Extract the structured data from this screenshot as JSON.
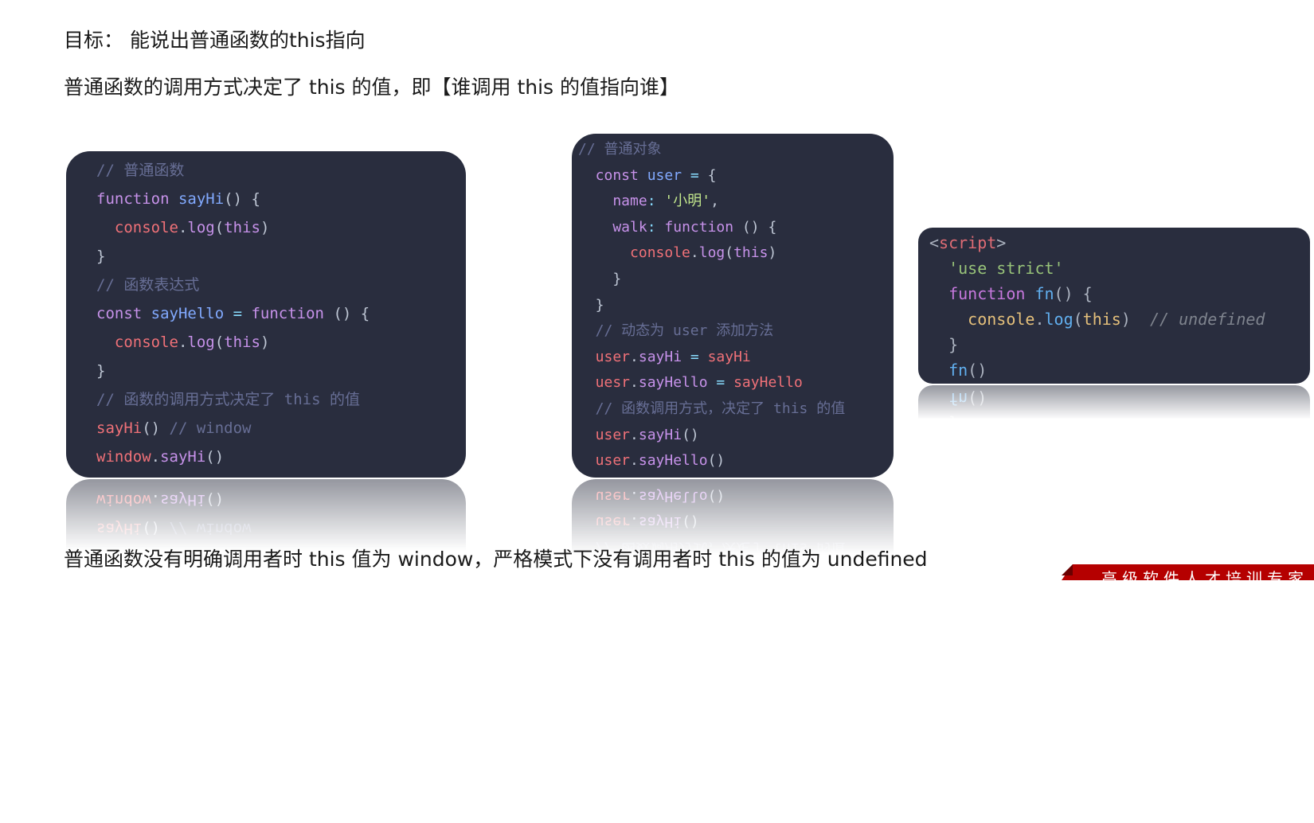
{
  "headings": {
    "goal": "目标： 能说出普通函数的this指向",
    "rule": "普通函数的调用方式决定了 this 的值，即【谁调用 this 的值指向谁】",
    "conclusion": "普通函数没有明确调用者时 this 值为 window，严格模式下没有调用者时 this 的值为 undefined"
  },
  "code_blocks": [
    {
      "name": "normal-function-code",
      "lines": [
        [
          [
            "// 普通函数",
            "cm"
          ]
        ],
        [
          [
            "function ",
            "kw"
          ],
          [
            "sayHi",
            "fn"
          ],
          [
            "() {",
            "pn"
          ]
        ],
        [
          [
            "  console",
            "rd"
          ],
          [
            ".",
            "pn"
          ],
          [
            "log",
            "kw"
          ],
          [
            "(",
            "pn"
          ],
          [
            "this",
            "kw"
          ],
          [
            ")",
            "pn"
          ]
        ],
        [
          [
            "}",
            "pn"
          ]
        ],
        [
          [
            "// 函数表达式",
            "cm"
          ]
        ],
        [
          [
            "const ",
            "kw"
          ],
          [
            "sayHello",
            "fn"
          ],
          [
            " = ",
            "op"
          ],
          [
            "function",
            "kw"
          ],
          [
            " () {",
            "pn"
          ]
        ],
        [
          [
            "  console",
            "rd"
          ],
          [
            ".",
            "pn"
          ],
          [
            "log",
            "kw"
          ],
          [
            "(",
            "pn"
          ],
          [
            "this",
            "kw"
          ],
          [
            ")",
            "pn"
          ]
        ],
        [
          [
            "}",
            "pn"
          ]
        ],
        [
          [
            "// 函数的调用方式决定了 this 的值",
            "cm"
          ]
        ],
        [
          [
            "sayHi",
            "rd"
          ],
          [
            "() ",
            "pn"
          ],
          [
            "// window",
            "cm"
          ]
        ],
        [
          [
            "window",
            "rd"
          ],
          [
            ".",
            "pn"
          ],
          [
            "sayHi",
            "kw"
          ],
          [
            "()",
            "pn"
          ]
        ]
      ]
    },
    {
      "name": "object-method-code",
      "lines": [
        [
          [
            "// 普通对象",
            "cm"
          ]
        ],
        [
          [
            "  const ",
            "kw"
          ],
          [
            "user",
            "fn"
          ],
          [
            " = ",
            "op"
          ],
          [
            "{",
            "pn"
          ]
        ],
        [
          [
            "    name",
            "kw"
          ],
          [
            ": ",
            "op"
          ],
          [
            "'小明'",
            "st"
          ],
          [
            ",",
            "pn"
          ]
        ],
        [
          [
            "    walk",
            "kw"
          ],
          [
            ": ",
            "op"
          ],
          [
            "function",
            "kw"
          ],
          [
            " () {",
            "pn"
          ]
        ],
        [
          [
            "      console",
            "rd"
          ],
          [
            ".",
            "pn"
          ],
          [
            "log",
            "kw"
          ],
          [
            "(",
            "pn"
          ],
          [
            "this",
            "kw"
          ],
          [
            ")",
            "pn"
          ]
        ],
        [
          [
            "    }",
            "pn"
          ]
        ],
        [
          [
            "  }",
            "pn"
          ]
        ],
        [
          [
            "  // 动态为 user 添加方法",
            "cm"
          ]
        ],
        [
          [
            "  user",
            "rd"
          ],
          [
            ".",
            "pn"
          ],
          [
            "sayHi",
            "kw"
          ],
          [
            " = ",
            "op"
          ],
          [
            "sayHi",
            "rd"
          ]
        ],
        [
          [
            "  uesr",
            "rd"
          ],
          [
            ".",
            "pn"
          ],
          [
            "sayHello",
            "kw"
          ],
          [
            " = ",
            "op"
          ],
          [
            "sayHello",
            "rd"
          ]
        ],
        [
          [
            "  // 函数调用方式，决定了 this 的值",
            "cm"
          ]
        ],
        [
          [
            "  user",
            "rd"
          ],
          [
            ".",
            "pn"
          ],
          [
            "sayHi",
            "kw"
          ],
          [
            "()",
            "pn"
          ]
        ],
        [
          [
            "  user",
            "rd"
          ],
          [
            ".",
            "pn"
          ],
          [
            "sayHello",
            "kw"
          ],
          [
            "()",
            "pn"
          ]
        ]
      ]
    },
    {
      "name": "strict-mode-code",
      "lines": [
        [
          [
            "<",
            "dp"
          ],
          [
            "script",
            "tg"
          ],
          [
            ">",
            "dp"
          ]
        ],
        [
          [
            "  'use strict'",
            "ds"
          ]
        ],
        [
          [
            "  function ",
            "dk"
          ],
          [
            "fn",
            "db"
          ],
          [
            "() {",
            "dp"
          ]
        ],
        [
          [
            "    console",
            "dy"
          ],
          [
            ".",
            "dp"
          ],
          [
            "log",
            "db"
          ],
          [
            "(",
            "dp"
          ],
          [
            "this",
            "dy"
          ],
          [
            ")",
            "dp"
          ],
          [
            "  // undefined",
            "dc"
          ]
        ],
        [
          [
            "  }",
            "dp"
          ]
        ],
        [
          [
            "  fn",
            "db"
          ],
          [
            "()",
            "dp"
          ]
        ]
      ]
    }
  ],
  "banner": {
    "text": "高级软件人才培训专家",
    "color": "#b50000"
  },
  "colors": {
    "code_background": "#292d3e",
    "page_background": "#ffffff"
  }
}
